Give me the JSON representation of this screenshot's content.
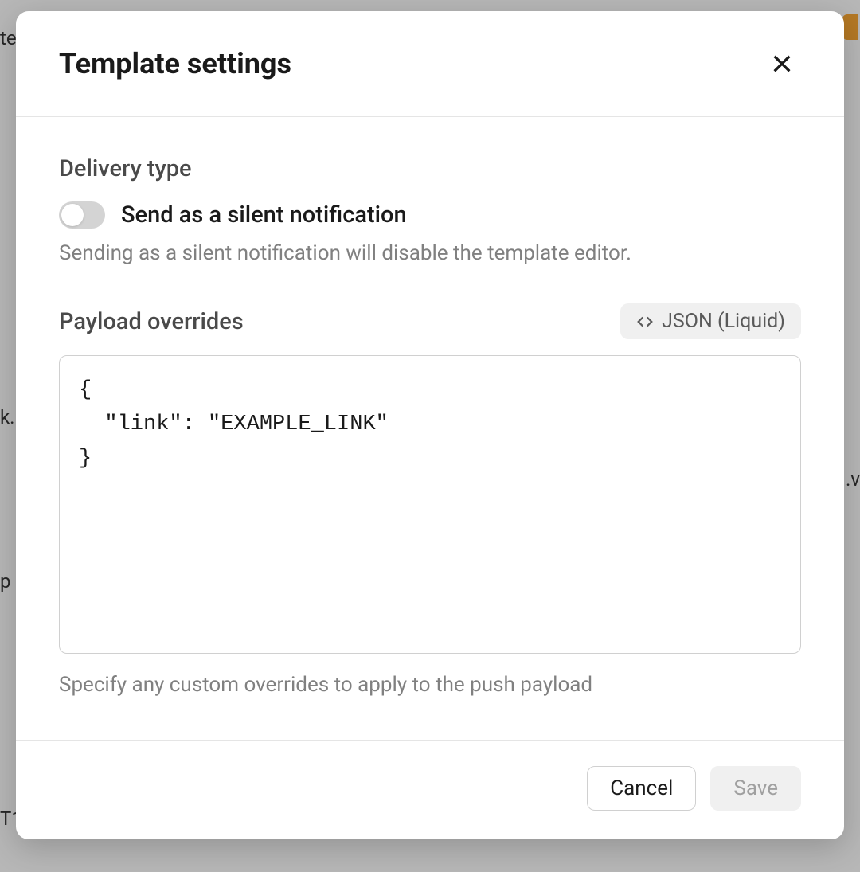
{
  "modal": {
    "title": "Template settings",
    "delivery": {
      "section_title": "Delivery type",
      "toggle_label": "Send as a silent notification",
      "helper_text": "Sending as a silent notification will disable the template editor.",
      "toggle_state": false
    },
    "payload": {
      "section_title": "Payload overrides",
      "format_label": "JSON (Liquid)",
      "editor_value": "{\n  \"link\": \"EXAMPLE_LINK\"\n}",
      "helper_text": "Specify any custom overrides to apply to the push payload"
    },
    "footer": {
      "cancel_label": "Cancel",
      "save_label": "Save"
    }
  },
  "background": {
    "fragments": [
      "te",
      "k.",
      "p",
      ".v",
      "T1"
    ]
  }
}
